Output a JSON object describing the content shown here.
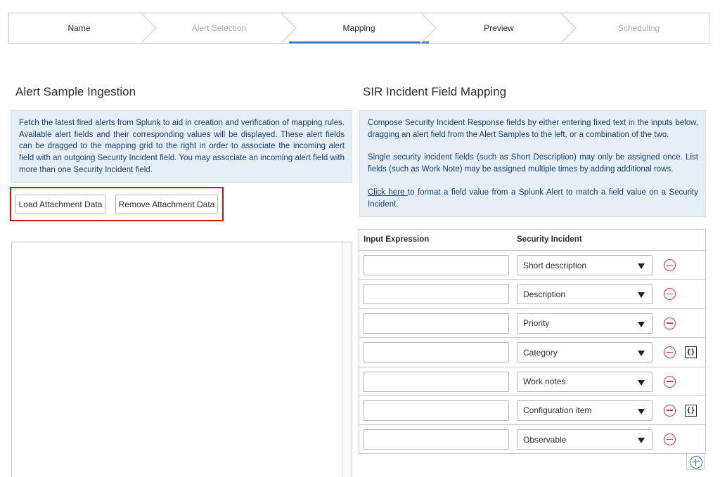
{
  "wizard": {
    "steps": [
      {
        "label": "Name",
        "state": "normal"
      },
      {
        "label": "Alert Selection",
        "state": "disabled"
      },
      {
        "label": "Mapping",
        "state": "active"
      },
      {
        "label": "Preview",
        "state": "normal"
      },
      {
        "label": "Scheduling",
        "state": "disabled"
      }
    ]
  },
  "left": {
    "title": "Alert Sample Ingestion",
    "info": "Fetch the latest fired alerts from Splunk to aid in creation and verification of mapping rules. Available alert fields and their corresponding values will be displayed. These alert fields can be dragged to the mapping grid to the right in order to associate the incoming alert field with an outgoing Security Incident field. You may associate an incoming alert field with more than one Security Incident field.",
    "load_button": "Load Attachment Data",
    "remove_button": "Remove Attachment Data"
  },
  "right": {
    "title": "SIR Incident Field Mapping",
    "info_p1": "Compose Security Incident Response fields by either entering fixed text in the inputs below, dragging an alert field from the Alert Samples to the left, or a combination of the two.",
    "info_p2": "Single security incident fields (such as Short Description) may only be assigned once. List fields (such as Work Note) may be assigned multiple times by adding additional rows.",
    "info_link": "Click here ",
    "info_p3_rest": " to format a field value from a Splunk Alert to match a field value on a Security Incident.",
    "grid": {
      "col_input": "Input Expression",
      "col_incident": "Security Incident",
      "rows": [
        {
          "value": "",
          "field": "Short description",
          "has_format": false
        },
        {
          "value": "",
          "field": "Description",
          "has_format": false
        },
        {
          "value": "",
          "field": "Priority",
          "has_format": false
        },
        {
          "value": "",
          "field": "Category",
          "has_format": true
        },
        {
          "value": "",
          "field": "Work notes",
          "has_format": false
        },
        {
          "value": "",
          "field": "Configuration item",
          "has_format": true
        },
        {
          "value": "",
          "field": "Observable",
          "has_format": false
        }
      ]
    }
  },
  "icons": {
    "remove_row": "minus-circle-icon",
    "format": "braces-icon",
    "add_row": "plus-circle-icon",
    "dropdown": "caret-down-icon"
  },
  "colors": {
    "accent": "#3b7bd6",
    "info_bg": "#e6eef8",
    "info_text": "#1a3f73",
    "highlight": "#e20a0a",
    "remove": "#e0393e",
    "add": "#2a73d9"
  }
}
